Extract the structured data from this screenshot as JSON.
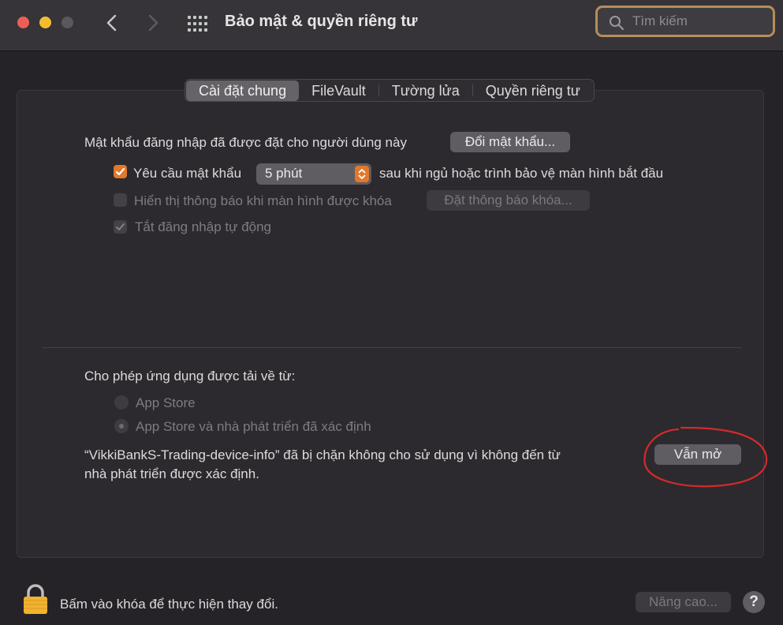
{
  "window": {
    "title": "Bảo mật & quyền riêng tư"
  },
  "search": {
    "placeholder": "Tìm kiếm"
  },
  "tabs": [
    {
      "label": "Cài đặt chung",
      "selected": true
    },
    {
      "label": "FileVault"
    },
    {
      "label": "Tường lửa"
    },
    {
      "label": "Quyền riêng tư"
    }
  ],
  "general": {
    "password_text": "Mật khẩu đăng nhập đã được đặt cho người dùng này",
    "change_password_button": "Đổi mật khẩu...",
    "require_password": {
      "checked": true,
      "label": "Yêu cầu mật khẩu",
      "delay_value": "5 phút",
      "suffix": "sau khi ngủ hoặc trình bảo vệ màn hình bắt đầu"
    },
    "show_message": {
      "checked": false,
      "enabled": false,
      "label": "Hiển thị thông báo khi màn hình được khóa",
      "button": "Đặt thông báo khóa..."
    },
    "disable_auto_login": {
      "checked": true,
      "enabled": false,
      "label": "Tắt đăng nhập tự động"
    }
  },
  "downloads": {
    "heading": "Cho phép ứng dụng được tải về từ:",
    "options": [
      {
        "label": "App Store",
        "selected": false
      },
      {
        "label": "App Store và nhà phát triển đã xác định",
        "selected": true
      }
    ],
    "blocked_line1": "“VikkiBankS-Trading-device-info” đã bị chặn không cho sử dụng vì không đến từ",
    "blocked_line2": "nhà phát triển được xác định.",
    "open_anyway_button": "Vẫn mở"
  },
  "footer": {
    "lock_text": "Bấm vào khóa để thực hiện thay đổi.",
    "advanced_button": "Nâng cao...",
    "help_button": "?"
  },
  "colors": {
    "accent": "#e1782c",
    "annotation": "#d42a2a",
    "search_focus": "#b58e5c"
  },
  "icons": [
    "search-icon",
    "chevron-left-icon",
    "chevron-right-icon",
    "grid-icon",
    "checkmark-icon",
    "stepper-arrows-icon",
    "lock-icon",
    "help-icon"
  ]
}
